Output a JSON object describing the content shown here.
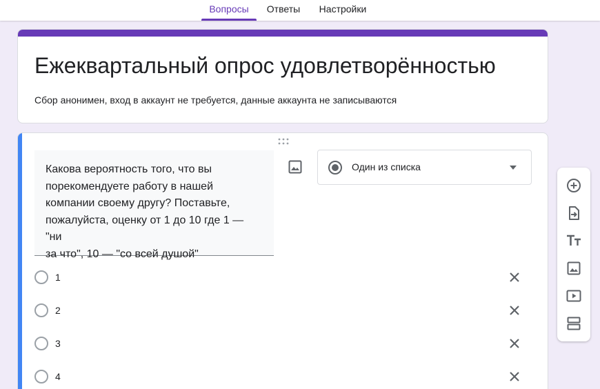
{
  "tabs": [
    {
      "label": "Вопросы",
      "active": true
    },
    {
      "label": "Ответы",
      "active": false
    },
    {
      "label": "Настройки",
      "active": false
    }
  ],
  "form": {
    "title": "Ежеквартальный опрос удовлетворённостью",
    "description": "Сбор анонимен, вход в аккаунт не требуется, данные аккаунта не записываются",
    "accent_color": "#673ab7",
    "background_color": "#f0ebf8"
  },
  "question": {
    "lines": [
      "Какова вероятность того, что вы",
      "порекомендуете работу в нашей",
      "компании своему другу? Поставьте,",
      "пожалуйста, оценку от 1 до 10 где 1 — \"ни",
      "за что\", 10 — \"со всей душой\""
    ],
    "type_label": "Один из списка",
    "type_icon": "radio-checked-icon",
    "active_color": "#4285f4",
    "options": [
      {
        "label": "1"
      },
      {
        "label": "2"
      },
      {
        "label": "3"
      },
      {
        "label": "4"
      }
    ]
  },
  "toolbar": {
    "tools": [
      {
        "name": "add-question-icon"
      },
      {
        "name": "import-questions-icon"
      },
      {
        "name": "add-title-icon"
      },
      {
        "name": "add-image-icon"
      },
      {
        "name": "add-video-icon"
      },
      {
        "name": "add-section-icon"
      }
    ]
  }
}
